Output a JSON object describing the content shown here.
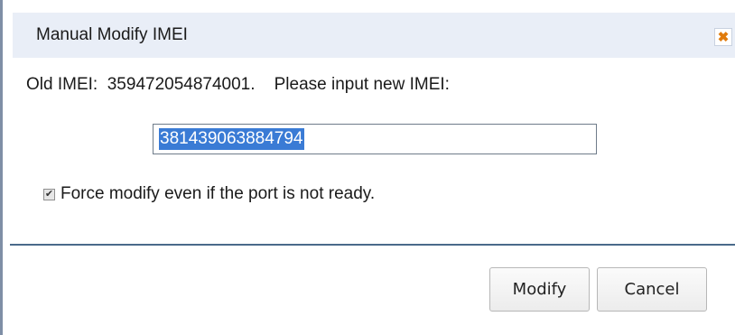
{
  "dialog": {
    "title": "Manual Modify IMEI",
    "close_icon": "close-icon",
    "close_color": "#e07b0c"
  },
  "info": {
    "text": "Old IMEI:  359472054874001.    Please input new IMEI:"
  },
  "imei_input": {
    "value": "381439063884794",
    "selection_color": "#3a7bd5"
  },
  "force_option": {
    "checked": true,
    "label": "Force modify even if the port is not ready."
  },
  "buttons": {
    "modify_label": "Modify",
    "cancel_label": "Cancel"
  }
}
